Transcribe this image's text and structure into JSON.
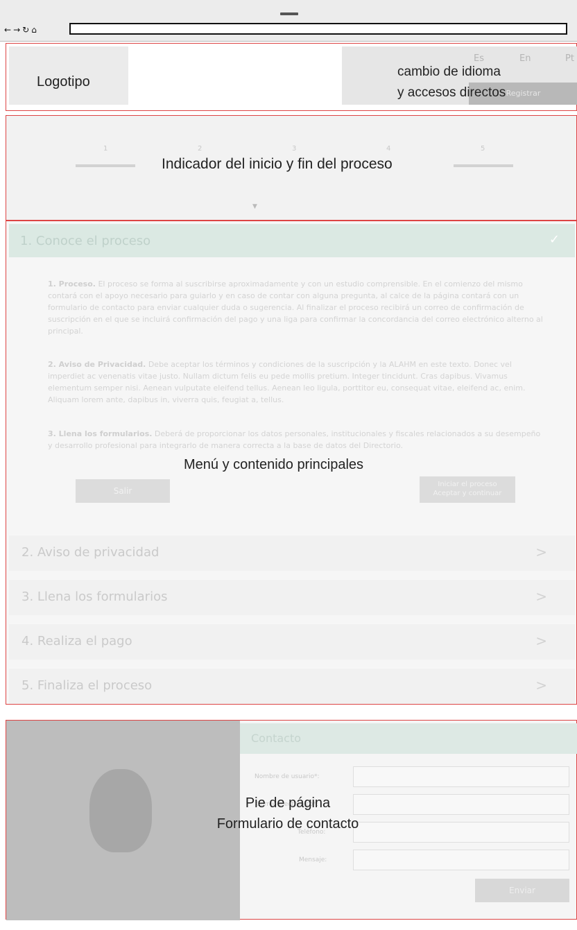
{
  "browser": {
    "nav_icons": [
      "←",
      "→",
      "↻",
      "⌂"
    ],
    "address": ""
  },
  "header": {
    "logo_label": "Logotipo",
    "languages": [
      "Es",
      "En",
      "Pt"
    ],
    "shortcut_button": "Registrar",
    "lang_label_line1": "cambio de idioma",
    "lang_label_line2": "y accesos directos"
  },
  "progress": {
    "steps": [
      "1",
      "2",
      "3",
      "4",
      "5"
    ],
    "label": "Indicador del inicio y fin del proceso",
    "arrow": "▼"
  },
  "main": {
    "active_section": {
      "title": "1. Conoce el proceso",
      "icon": "✓",
      "paragraphs": [
        {
          "heading": "1. Proceso.",
          "text": " El proceso se forma al suscribirse aproximadamente y con un estudio comprensible. En el comienzo del mismo contará con el apoyo necesario para guiarlo y en caso de contar con alguna pregunta, al calce de la página contará con un formulario de contacto para enviar cualquier duda o sugerencia. Al finalizar el proceso recibirá un correo de confirmación de suscripción en el que se incluirá confirmación del pago y una liga para confirmar la concordancia del correo electrónico alterno al principal."
        },
        {
          "heading": "2. Aviso de Privacidad.",
          "text": " Debe aceptar los términos y condiciones de la suscripción y la ALAHM en este texto. Donec vel imperdiet ac venenatis vitae justo. Nullam dictum felis eu pede mollis pretium. Integer tincidunt. Cras dapibus. Vivamus elementum semper nisi. Aenean vulputate eleifend tellus. Aenean leo ligula, porttitor eu, consequat vitae, eleifend ac, enim. Aliquam lorem ante, dapibus in, viverra quis, feugiat a, tellus."
        },
        {
          "heading": "3. Llena los formularios.",
          "text": " Deberá de proporcionar los datos personales, institucionales y fiscales relacionados a su desempeño y desarrollo profesional para integrarlo de manera correcta a la base de datos del Directorio."
        }
      ],
      "back_button": "Salir",
      "next_button_line1": "Iniciar el proceso",
      "next_button_line2": "Aceptar y continuar"
    },
    "label": "Menú y contenido principales",
    "sections": [
      {
        "title": "2. Aviso de privacidad",
        "icon": ">"
      },
      {
        "title": "3. Llena los formularios",
        "icon": ">"
      },
      {
        "title": "4. Realiza el pago",
        "icon": ">"
      },
      {
        "title": "5. Finaliza el proceso",
        "icon": ">"
      }
    ]
  },
  "footer": {
    "contact_title": "Contacto",
    "fields": [
      {
        "label": "Nombre de usuario*:",
        "value": ""
      },
      {
        "label": "Correo electrónico*:",
        "value": ""
      },
      {
        "label": "Teléfono:",
        "value": ""
      },
      {
        "label": "Mensaje:",
        "value": ""
      }
    ],
    "send_button": "Enviar",
    "label_line1": "Pie de página",
    "label_line2": "Formulario de contacto"
  }
}
